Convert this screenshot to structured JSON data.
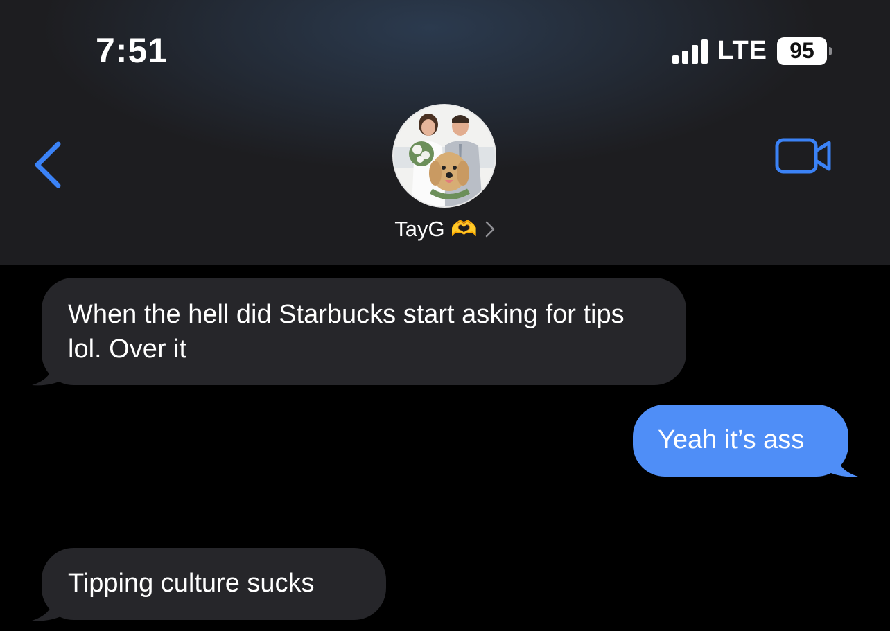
{
  "status_bar": {
    "time": "7:51",
    "network": "LTE",
    "battery": "95"
  },
  "header": {
    "contact_name": "TayG 🫶",
    "accent_color": "#3b82f6",
    "back_icon": "chevron-left-icon",
    "video_icon": "video-camera-icon"
  },
  "messages": [
    {
      "direction": "incoming",
      "text": "When the hell did Starbucks start asking for tips lol. Over it"
    },
    {
      "direction": "outgoing",
      "text": "Yeah it’s ass"
    },
    {
      "direction": "incoming",
      "text": "Tipping culture sucks"
    }
  ],
  "colors": {
    "incoming_bubble": "#26262a",
    "outgoing_bubble": "#4f8ef7",
    "background": "#000000"
  }
}
